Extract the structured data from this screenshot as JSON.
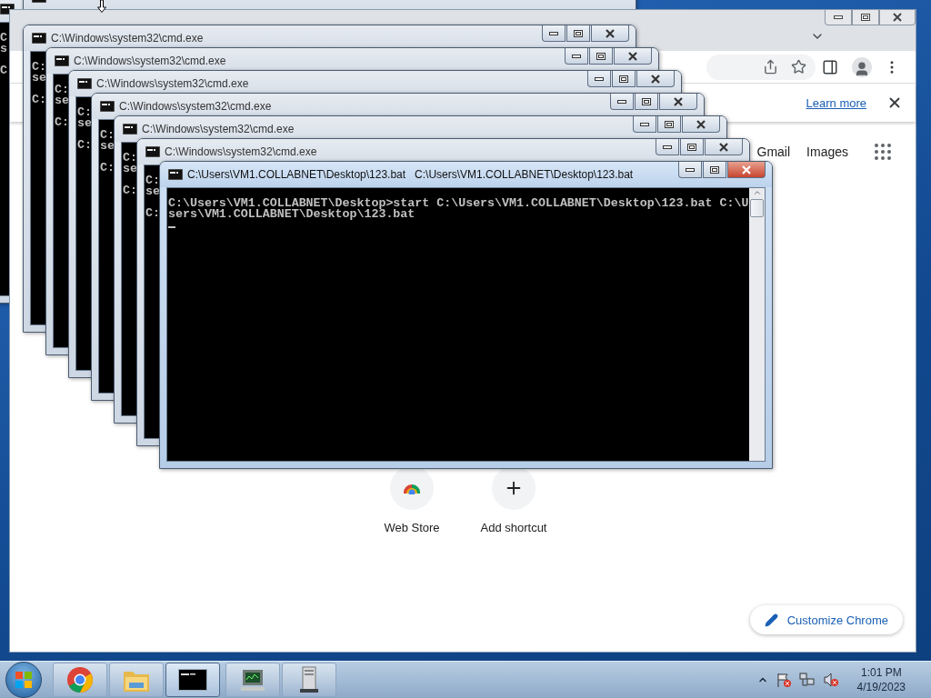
{
  "background_windows": [
    {
      "active": false,
      "lines": [
        "C",
        "s"
      ],
      "prompt": "C"
    },
    {
      "active": false
    }
  ],
  "browser": {
    "infobar": {
      "link": "Learn more"
    },
    "header_links": [
      "Gmail",
      "Images"
    ],
    "shortcuts": [
      {
        "label": "Web Store",
        "kind": "store"
      },
      {
        "label": "Add shortcut",
        "kind": "add"
      }
    ],
    "customize_button": "Customize Chrome"
  },
  "console_windows": [
    {
      "title": "C:\\Windows\\system32\\cmd.exe",
      "active": false,
      "lines": [
        "C:",
        "se"
      ],
      "prompt": "C:"
    },
    {
      "title": "C:\\Windows\\system32\\cmd.exe",
      "active": false,
      "lines": [
        "C:",
        "se"
      ],
      "prompt": "C:"
    },
    {
      "title": "C:\\Windows\\system32\\cmd.exe",
      "active": false,
      "lines": [
        "C:",
        "se"
      ],
      "prompt": "C:"
    },
    {
      "title": "C:\\Windows\\system32\\cmd.exe",
      "active": false,
      "lines": [
        "C:",
        "se"
      ],
      "prompt": "C:"
    },
    {
      "title": "C:\\Windows\\system32\\cmd.exe",
      "active": false,
      "lines": [
        "C:",
        "se"
      ],
      "prompt": "C:"
    },
    {
      "title": "C:\\Windows\\system32\\cmd.exe",
      "active": false,
      "lines": [
        "C:",
        "se"
      ],
      "prompt": "C:"
    },
    {
      "title": "C:\\Users\\VM1.COLLABNET\\Desktop\\123.bat   C:\\Users\\VM1.COLLABNET\\Desktop\\123.bat",
      "active": true,
      "lines": [
        "C:\\Users\\VM1.COLLABNET\\Desktop>start C:\\Users\\VM1.COLLABNET\\Desktop\\123.bat C:\\U",
        "sers\\VM1.COLLABNET\\Desktop\\123.bat"
      ],
      "cursor": true
    }
  ],
  "taskbar": {
    "buttons": [
      {
        "kind": "chrome",
        "active": false
      },
      {
        "kind": "folder",
        "active": false
      },
      {
        "kind": "console",
        "active": true
      },
      {
        "kind": "monitor",
        "active": false
      },
      {
        "kind": "server",
        "active": false
      }
    ],
    "tray": {
      "time": "1:01 PM",
      "date": "4/19/2023"
    }
  }
}
